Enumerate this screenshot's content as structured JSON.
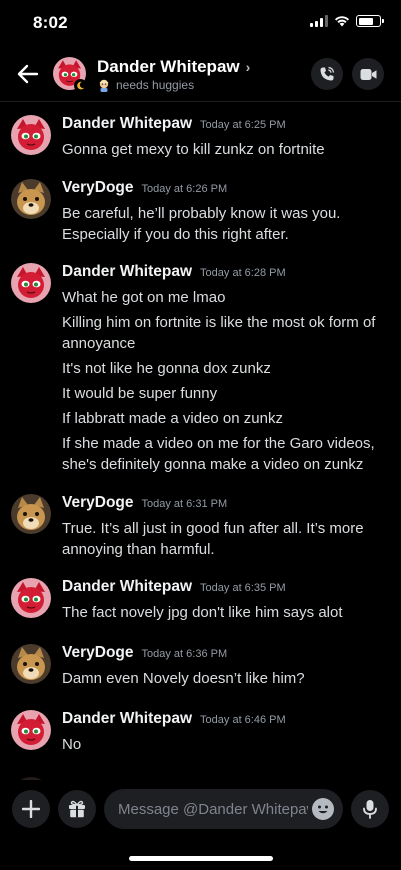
{
  "status_bar": {
    "time": "8:02",
    "battery_level": 0.7
  },
  "header": {
    "name": "Dander Whitepaw",
    "chevron": "›",
    "status_text": "needs huggies"
  },
  "messages": [
    {
      "author": "Dander Whitepaw",
      "time": "Today at 6:25 PM",
      "avatar": "red-cat-avatar",
      "lines": [
        "Gonna get mexy to kill zunkz on fortnite"
      ]
    },
    {
      "author": "VeryDoge",
      "time": "Today at 6:26 PM",
      "avatar": "doge-avatar",
      "lines": [
        "Be careful, he’ll probably know it was you.",
        "Especially if you do this right after."
      ]
    },
    {
      "author": "Dander Whitepaw",
      "time": "Today at 6:28 PM",
      "avatar": "red-cat-avatar",
      "lines": [
        "What he got on me lmao",
        "Killing him on fortnite is like the most ok form of",
        "annoyance",
        "It's not like he gonna dox zunkz",
        "It would be super funny",
        "If labbratt made a video on zunkz",
        "If she made a video on me for the Garo videos,",
        "she's definitely gonna make a video on zunkz"
      ]
    },
    {
      "author": "VeryDoge",
      "time": "Today at 6:31 PM",
      "avatar": "doge-avatar",
      "lines": [
        "True. It’s all just in good fun after all. It’s more",
        "annoying than harmful."
      ]
    },
    {
      "author": "Dander Whitepaw",
      "time": "Today at 6:35 PM",
      "avatar": "red-cat-avatar",
      "lines": [
        "The fact novely jpg don't like him says alot"
      ]
    },
    {
      "author": "VeryDoge",
      "time": "Today at 6:36 PM",
      "avatar": "doge-avatar",
      "lines": [
        "Damn even Novely doesn’t like him?"
      ]
    },
    {
      "author": "Dander Whitepaw",
      "time": "Today at 6:46 PM",
      "avatar": "red-cat-avatar",
      "lines": [
        "No"
      ]
    }
  ],
  "composer": {
    "placeholder": "Message @Dander Whitepaw"
  },
  "icons": {
    "back": "arrow-left-icon",
    "call": "phone-icon",
    "video": "video-camera-icon",
    "add": "plus-icon",
    "gift": "gift-icon",
    "emoji": "emoji-icon",
    "voice": "microphone-icon"
  },
  "colors": {
    "background": "#000000",
    "text": "#dbdee1",
    "muted": "#949ba4",
    "control_bg": "#1e1f22"
  }
}
